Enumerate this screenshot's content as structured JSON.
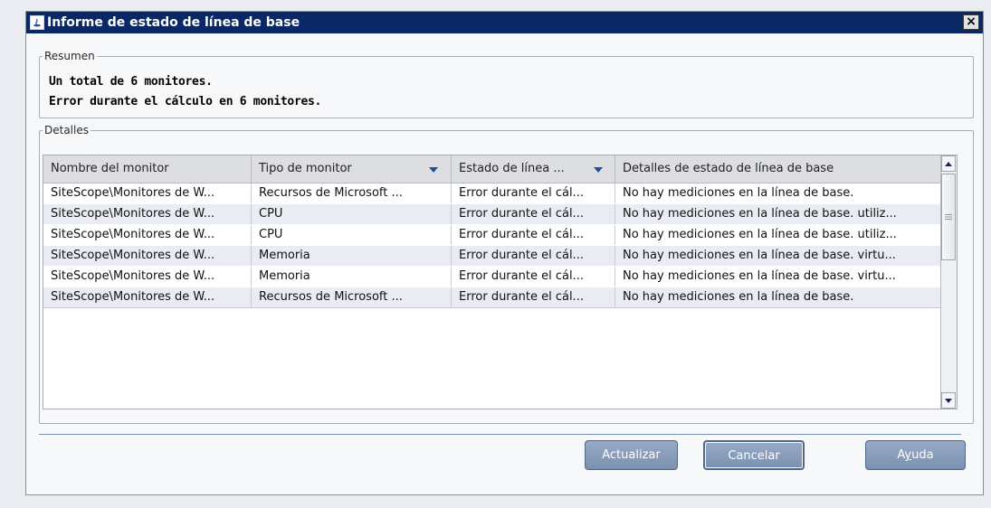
{
  "window": {
    "title": "Informe de estado de línea de base",
    "close_glyph": "×"
  },
  "summary": {
    "legend": "Resumen",
    "line1": "Un total de 6 monitores.",
    "line2": "Error durante el cálculo en 6 monitores."
  },
  "details": {
    "legend": "Detalles",
    "columns": [
      "Nombre del monitor",
      "Tipo de monitor",
      "Estado de línea ...",
      "Detalles de estado de línea de base"
    ],
    "rows": [
      [
        "SiteScope\\Monitores de W...",
        "Recursos de Microsoft ...",
        "Error durante el cál...",
        "No hay mediciones en la línea de base."
      ],
      [
        "SiteScope\\Monitores de W...",
        "CPU",
        "Error durante el cál...",
        "No hay mediciones en la línea de base. utiliz..."
      ],
      [
        "SiteScope\\Monitores de W...",
        "CPU",
        "Error durante el cál...",
        "No hay mediciones en la línea de base. utiliz..."
      ],
      [
        "SiteScope\\Monitores de W...",
        "Memoria",
        "Error durante el cál...",
        "No hay mediciones en la línea de base. virtu..."
      ],
      [
        "SiteScope\\Monitores de W...",
        "Memoria",
        "Error durante el cál...",
        "No hay mediciones en la línea de base. virtu..."
      ],
      [
        "SiteScope\\Monitores de W...",
        "Recursos de Microsoft ...",
        "Error durante el cál...",
        "No hay mediciones en la línea de base."
      ]
    ]
  },
  "buttons": {
    "refresh": "Actualizar",
    "cancel": "Cancelar",
    "help_prefix": "A",
    "help_mnemonic": "y",
    "help_suffix": "uda"
  },
  "colors": {
    "titlebar": "#0a2766",
    "button": "#8a9dbb",
    "row_alt": "#eaecf4"
  }
}
